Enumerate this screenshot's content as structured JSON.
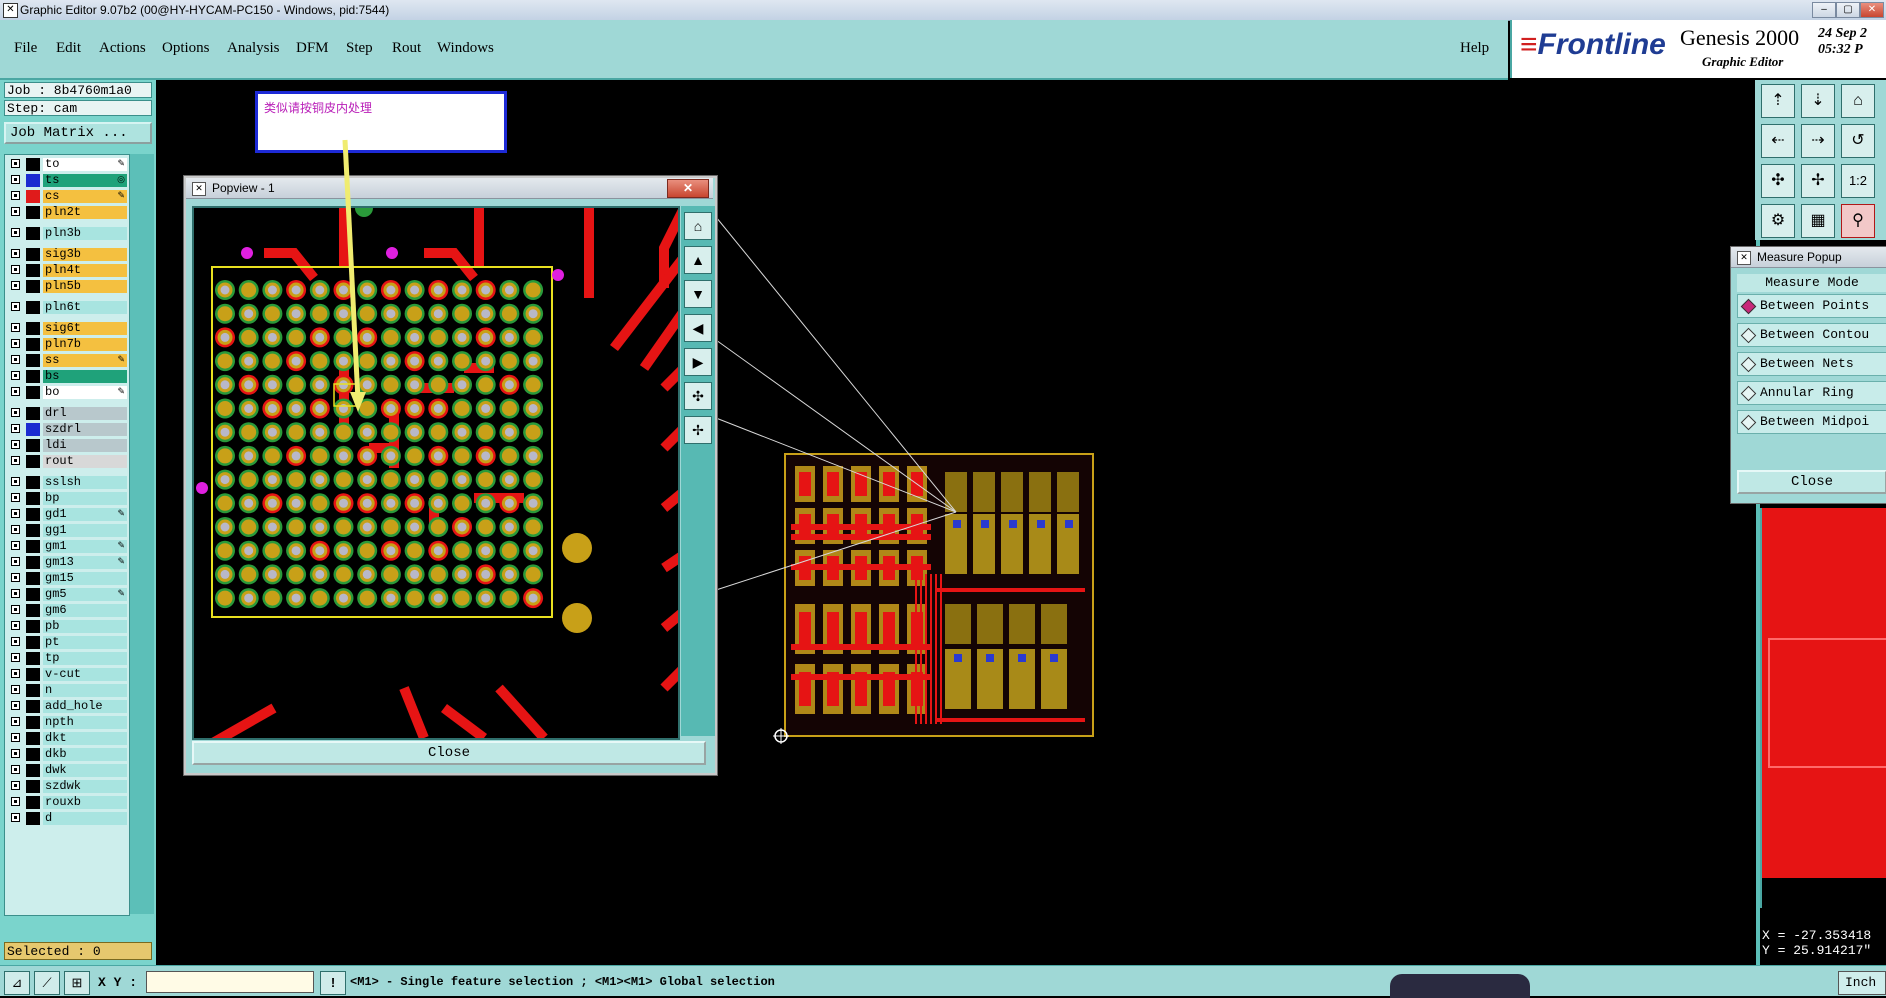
{
  "window": {
    "title": "Graphic Editor 9.07b2 (00@HY-HYCAM-PC150 - Windows, pid:7544)"
  },
  "menu": {
    "items": [
      "File",
      "Edit",
      "Actions",
      "Options",
      "Analysis",
      "DFM",
      "Step",
      "Rout",
      "Windows"
    ],
    "help": "Help"
  },
  "brand": {
    "company": "Frontline",
    "product": "Genesis 2000",
    "subtitle": "Graphic Editor",
    "date": "24 Sep 2",
    "time": "05:32 P"
  },
  "job": {
    "job_line": "Job : 8b4760m1a0",
    "step_line": "Step: cam",
    "matrix_button": "Job Matrix ..."
  },
  "layers": [
    {
      "name": "to",
      "color": "#ffffff",
      "swatch": "#000000",
      "mark": "✎"
    },
    {
      "name": "ts",
      "color": "#1fa27a",
      "swatch": "#1b2bd0",
      "mark": "◎"
    },
    {
      "name": "cs",
      "color": "#f4c040",
      "swatch": "#e01b1b",
      "mark": "✎"
    },
    {
      "name": "pln2t",
      "color": "#f4c040",
      "swatch": "#000000",
      "mark": ""
    },
    {
      "name": "pln3b",
      "color": "#a8e4e0",
      "swatch": "#000000",
      "mark": ""
    },
    {
      "name": "sig3b",
      "color": "#f4c040",
      "swatch": "#000000",
      "mark": ""
    },
    {
      "name": "pln4t",
      "color": "#f4c040",
      "swatch": "#000000",
      "mark": ""
    },
    {
      "name": "pln5b",
      "color": "#f4c040",
      "swatch": "#000000",
      "mark": ""
    },
    {
      "name": "pln6t",
      "color": "#a8e4e0",
      "swatch": "#000000",
      "mark": ""
    },
    {
      "name": "sig6t",
      "color": "#f4c040",
      "swatch": "#000000",
      "mark": ""
    },
    {
      "name": "pln7b",
      "color": "#f4c040",
      "swatch": "#000000",
      "mark": ""
    },
    {
      "name": "ss",
      "color": "#f4c040",
      "swatch": "#000000",
      "mark": "✎"
    },
    {
      "name": "bs",
      "color": "#1fa27a",
      "swatch": "#000000",
      "mark": ""
    },
    {
      "name": "bo",
      "color": "#ffffff",
      "swatch": "#000000",
      "mark": "✎"
    },
    {
      "name": "drl",
      "color": "#b8c8cc",
      "swatch": "#000000",
      "mark": ""
    },
    {
      "name": "szdrl",
      "color": "#b8c8cc",
      "swatch": "#1b2bd0",
      "mark": ""
    },
    {
      "name": "ldi",
      "color": "#b8c8cc",
      "swatch": "#000000",
      "mark": ""
    },
    {
      "name": "rout",
      "color": "#d8d8d8",
      "swatch": "#000000",
      "mark": ""
    },
    {
      "name": "sslsh",
      "color": "#a8e4e0",
      "swatch": "#000000",
      "mark": ""
    },
    {
      "name": "bp",
      "color": "#a8e4e0",
      "swatch": "#000000",
      "mark": ""
    },
    {
      "name": "gd1",
      "color": "#a8e4e0",
      "swatch": "#000000",
      "mark": "✎"
    },
    {
      "name": "gg1",
      "color": "#a8e4e0",
      "swatch": "#000000",
      "mark": ""
    },
    {
      "name": "gm1",
      "color": "#a8e4e0",
      "swatch": "#000000",
      "mark": "✎"
    },
    {
      "name": "gm13",
      "color": "#a8e4e0",
      "swatch": "#000000",
      "mark": "✎"
    },
    {
      "name": "gm15",
      "color": "#a8e4e0",
      "swatch": "#000000",
      "mark": ""
    },
    {
      "name": "gm5",
      "color": "#a8e4e0",
      "swatch": "#000000",
      "mark": "✎"
    },
    {
      "name": "gm6",
      "color": "#a8e4e0",
      "swatch": "#000000",
      "mark": ""
    },
    {
      "name": "pb",
      "color": "#a8e4e0",
      "swatch": "#000000",
      "mark": ""
    },
    {
      "name": "pt",
      "color": "#a8e4e0",
      "swatch": "#000000",
      "mark": ""
    },
    {
      "name": "tp",
      "color": "#a8e4e0",
      "swatch": "#000000",
      "mark": ""
    },
    {
      "name": "v-cut",
      "color": "#a8e4e0",
      "swatch": "#000000",
      "mark": ""
    },
    {
      "name": "n",
      "color": "#a8e4e0",
      "swatch": "#000000",
      "mark": ""
    },
    {
      "name": "add_hole",
      "color": "#a8e4e0",
      "swatch": "#000000",
      "mark": ""
    },
    {
      "name": "npth",
      "color": "#a8e4e0",
      "swatch": "#000000",
      "mark": ""
    },
    {
      "name": "dkt",
      "color": "#a8e4e0",
      "swatch": "#000000",
      "mark": ""
    },
    {
      "name": "dkb",
      "color": "#a8e4e0",
      "swatch": "#000000",
      "mark": ""
    },
    {
      "name": "dwk",
      "color": "#a8e4e0",
      "swatch": "#000000",
      "mark": ""
    },
    {
      "name": "szdwk",
      "color": "#a8e4e0",
      "swatch": "#000000",
      "mark": ""
    },
    {
      "name": "rouxb",
      "color": "#a8e4e0",
      "swatch": "#000000",
      "mark": ""
    },
    {
      "name": "d",
      "color": "#a8e4e0",
      "swatch": "#000000",
      "mark": ""
    }
  ],
  "selected": "Selected : 0",
  "annotation": {
    "text": "类似请按铜皮内处理"
  },
  "popview": {
    "title": "Popview - 1",
    "close_label": "Close",
    "close_x": "✕"
  },
  "measure": {
    "title": "Measure Popup",
    "mode_header": "Measure Mode",
    "options": [
      "Between Points",
      "Between Contou",
      "Between Nets",
      "Annular Ring",
      "Between Midpoi"
    ],
    "selected_index": 0,
    "close_label": "Close"
  },
  "coords": {
    "x": "X = -27.353418",
    "y": "Y = 25.914217\""
  },
  "status": {
    "xy_label": "X Y :",
    "message": "<M1> - Single feature selection ; <M1><M1> Global selection",
    "units": "Inch"
  },
  "colors": {
    "panel": "#9fd8d6",
    "pad_outer": "#c8a018",
    "pad_ring": "#2a9a3a",
    "pad_drill": "#b8b8c8",
    "trace": "#e61414",
    "via": "#e020e0",
    "outline": "#e8e020"
  }
}
